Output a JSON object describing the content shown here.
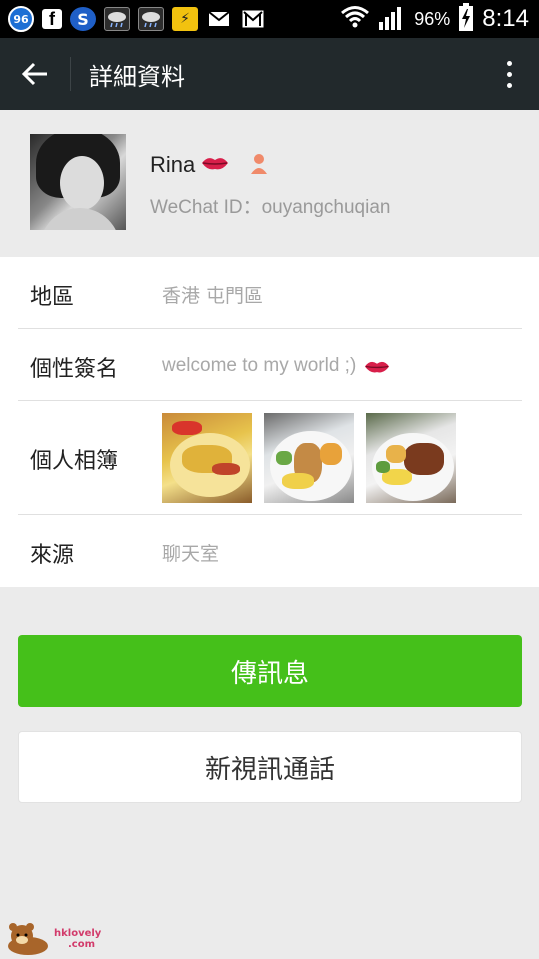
{
  "status_bar": {
    "badge": "96",
    "battery_percent": "96%",
    "time": "8:14",
    "icons": [
      "number-badge-icon",
      "facebook-icon",
      "s-app-icon",
      "weather-icon",
      "weather-icon",
      "warning-app-icon",
      "mail-icon",
      "gmail-icon",
      "wifi-icon",
      "signal-icon",
      "battery-charging-icon"
    ]
  },
  "header": {
    "title": "詳細資料"
  },
  "profile": {
    "name": "Rina",
    "wechat_id": "WeChat ID：ouyangchuqian"
  },
  "info_rows": {
    "region_label": "地區",
    "region_value": "香港  屯門區",
    "signature_label": "個性簽名",
    "signature_value": "welcome to my world ;)",
    "album_label": "個人相簿",
    "source_label": "來源",
    "source_value": "聊天室"
  },
  "actions": {
    "message_button": "傳訊息",
    "video_call_button": "新視訊通話"
  },
  "watermark": {
    "line1": "hklovely",
    "line2": ".com"
  },
  "colors": {
    "titlebar": "#22292c",
    "green_button": "#45c01a",
    "background": "#ebebeb"
  }
}
